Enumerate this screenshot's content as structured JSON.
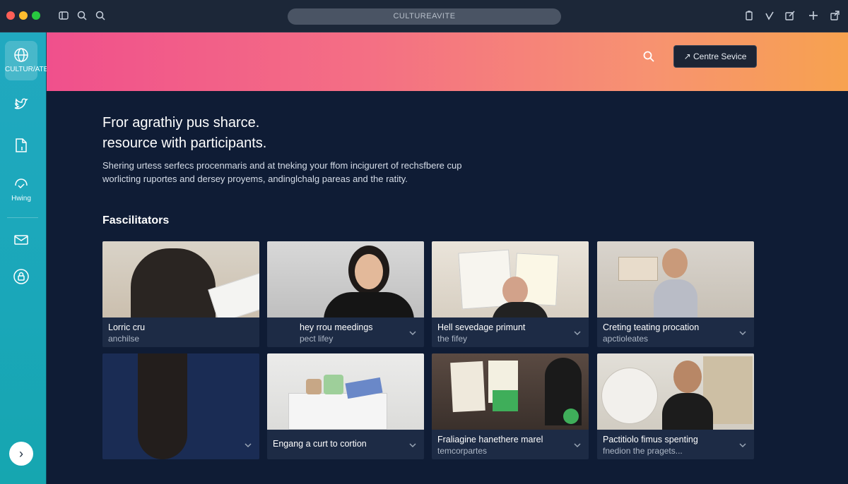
{
  "window": {
    "url_text": "CULTUREAVITE"
  },
  "sidebar": {
    "items": [
      {
        "icon": "globe-icon",
        "label": "CULTUR/ATE"
      },
      {
        "icon": "bird-icon",
        "label": ""
      },
      {
        "icon": "document-icon",
        "label": ""
      },
      {
        "icon": "handshake-icon",
        "label": "Hwing"
      },
      {
        "icon": "mail-icon",
        "label": ""
      },
      {
        "icon": "lock-icon",
        "label": ""
      }
    ],
    "expand_icon": "›"
  },
  "banner": {
    "button_label": "Centre Sevice"
  },
  "hero": {
    "title_line1": "Fror agrathiy pus sharce.",
    "title_line2": "resource with participants.",
    "subtitle_line1": "Shering urtess serfecs procenmaris and at tneking your ffom incigurert of rechsfbere cup",
    "subtitle_line2": "worlicting ruportes and dersey proyems, andinglchalg pareas and the ratity."
  },
  "section": {
    "title": "Fascilitators"
  },
  "cards": [
    {
      "title": "Lorric cru",
      "subtitle": "anchilse"
    },
    {
      "title": "hey rrou meedings",
      "subtitle": "pect lifey"
    },
    {
      "title": "Hell sevedage primunt",
      "subtitle": "the fifey"
    },
    {
      "title": "Creting teating procation",
      "subtitle": "apctioleates"
    },
    {
      "title": "",
      "subtitle": ""
    },
    {
      "title": "Engang a curt to cortion",
      "subtitle": ""
    },
    {
      "title": "Fraliagine hanethere marel",
      "subtitle": "temcorpartes"
    },
    {
      "title": "Pactitiolo fimus spenting",
      "subtitle": "fnedion the pragets..."
    }
  ],
  "colors": {
    "sidebar": "#21a9c0",
    "banner_start": "#f0508c",
    "banner_end": "#f7a24f",
    "page_bg": "#0f1c35"
  }
}
